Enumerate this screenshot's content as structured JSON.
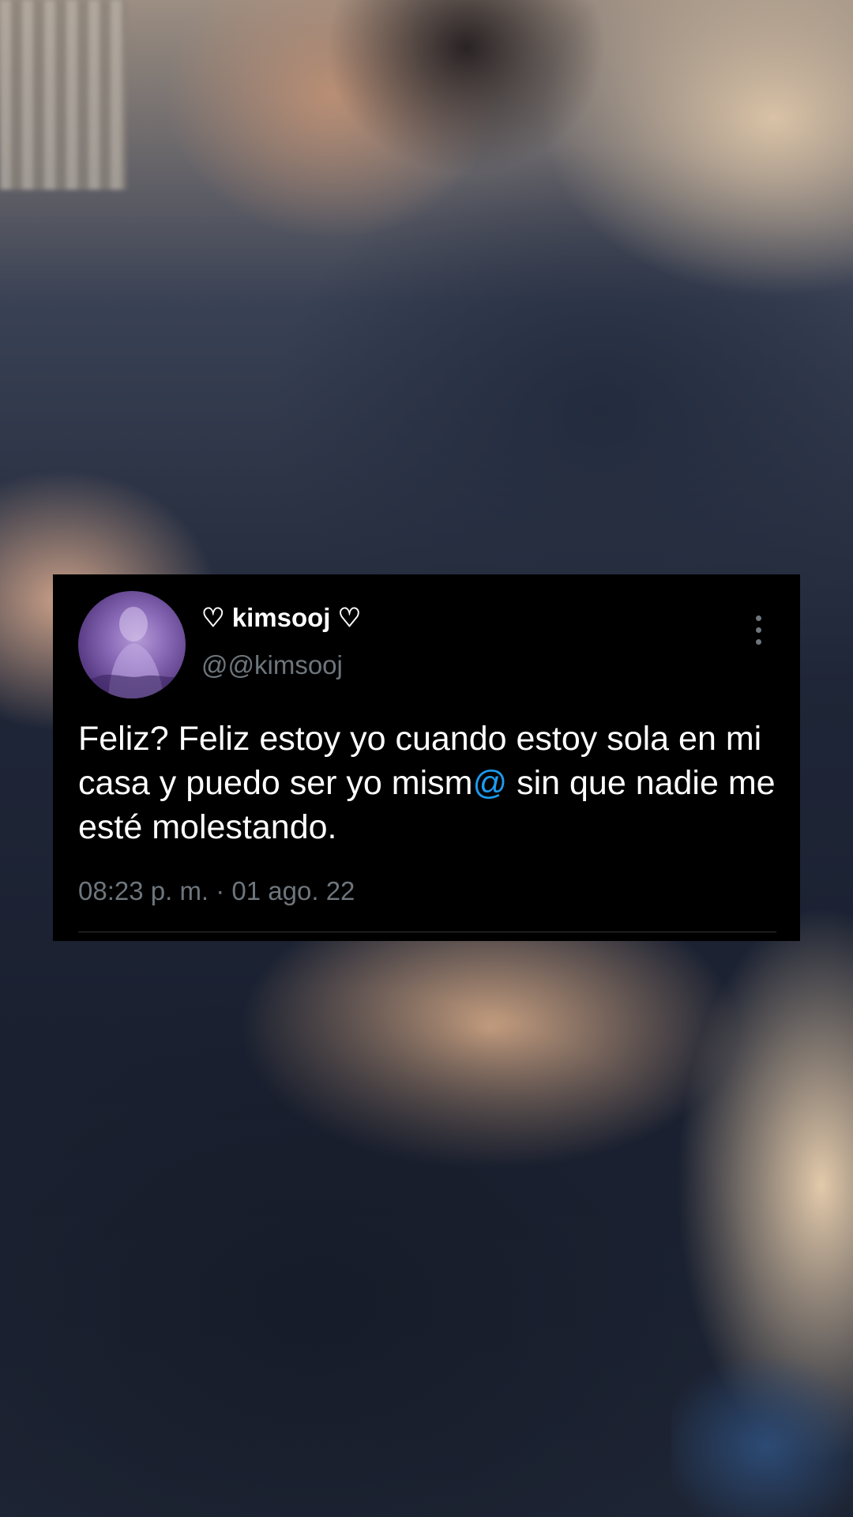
{
  "background": {
    "description_icon": "blurred-photo-background"
  },
  "tweet": {
    "display_name": "♡ kimsooj ♡",
    "handle": "@@kimsooj",
    "text_part1": "Feliz? Feliz estoy yo cuando estoy sola en mi casa y puedo ser yo mism",
    "text_mention": "@",
    "text_part2": " sin que nadie me esté molestando.",
    "timestamp": "08:23 p. m. · 01 ago. 22",
    "more_icon": "more-vertical-icon"
  },
  "colors": {
    "card_background": "#000000",
    "text_primary": "#ffffff",
    "text_secondary": "#6e767d",
    "accent_link": "#1d9bf0",
    "avatar_tint": "#8a6ab8"
  }
}
